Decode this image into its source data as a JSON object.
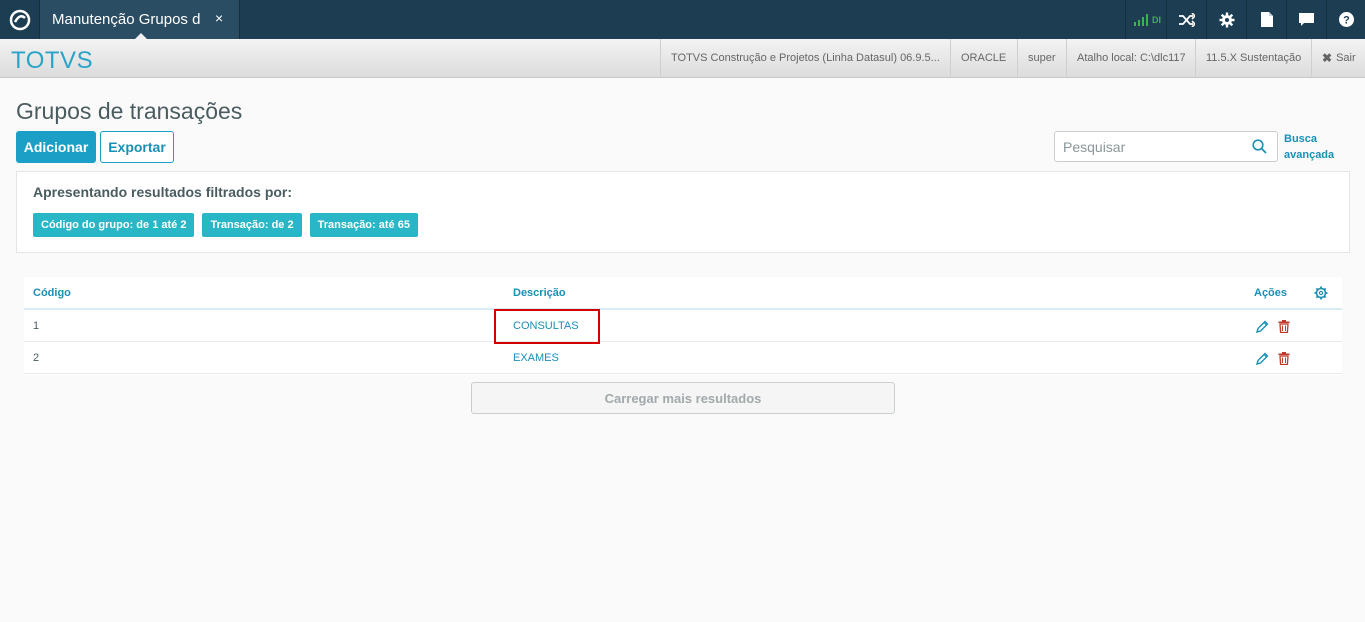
{
  "topbar": {
    "tab_title": "Manutenção Grupos d",
    "tab_close": "×",
    "signal_label": "DI",
    "icons": [
      "totvs-logo-icon",
      "shuffle-icon",
      "gear-icon",
      "document-icon",
      "chat-icon",
      "help-icon"
    ]
  },
  "infobar": {
    "brand": "TOTVS",
    "product": "TOTVS Construção e Projetos (Linha Datasul) 06.9.5...",
    "database": "ORACLE",
    "user": "super",
    "shortcut": "Atalho local: C:\\dlc117",
    "version": "11.5.X Sustentação",
    "exit": "Sair"
  },
  "page": {
    "title": "Grupos de transações",
    "add_label": "Adicionar",
    "export_label": "Exportar",
    "search_placeholder": "Pesquisar",
    "adv_search_line1": "Busca",
    "adv_search_line2": "avançada"
  },
  "filters": {
    "label": "Apresentando resultados filtrados por:",
    "chips": [
      "Código do grupo: de 1 até 2",
      "Transação: de 2",
      "Transação: até 65"
    ]
  },
  "table": {
    "headers": {
      "code": "Código",
      "description": "Descrição",
      "actions": "Ações"
    },
    "rows": [
      {
        "code": "1",
        "description": "CONSULTAS"
      },
      {
        "code": "2",
        "description": "EXAMES"
      }
    ]
  },
  "load_more": "Carregar mais resultados",
  "colors": {
    "accent": "#1b9fc7",
    "chip": "#29b6c6",
    "topbar": "#1d3e52",
    "delete": "#c0392b",
    "highlight": "#d40000"
  }
}
